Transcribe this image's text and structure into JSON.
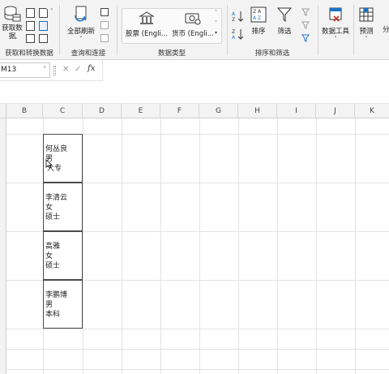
{
  "ribbon": {
    "get_transform": {
      "get_data_label": "获取数据",
      "group_label": "获取和转换数据"
    },
    "queries": {
      "refresh_all_label": "全部刷新",
      "group_label": "查询和连接"
    },
    "data_types": {
      "stocks_label": "股票 (Engli...",
      "currencies_label": "货币 (Engli...",
      "group_label": "数据类型"
    },
    "sort_filter": {
      "sort_label": "排序",
      "filter_label": "筛选",
      "group_label": "排序和筛选"
    },
    "data_tools": {
      "label": "数据工具"
    },
    "forecast": {
      "label": "预测"
    },
    "outline": {
      "label": "分"
    }
  },
  "formula_bar": {
    "name_box": "M13",
    "fx": "fx",
    "cancel": "✕",
    "enter": "✓"
  },
  "columns": [
    "B",
    "C",
    "D",
    "E",
    "F",
    "G",
    "H",
    "I",
    "J",
    "K"
  ],
  "cards": [
    {
      "name": "何丛良",
      "gender": "男",
      "education": "大专"
    },
    {
      "name": "李清云",
      "gender": "女",
      "education": "硕士"
    },
    {
      "name": "高雅",
      "gender": "女",
      "education": "硕士"
    },
    {
      "name": "李鹏博",
      "gender": "男",
      "education": "本科"
    }
  ]
}
